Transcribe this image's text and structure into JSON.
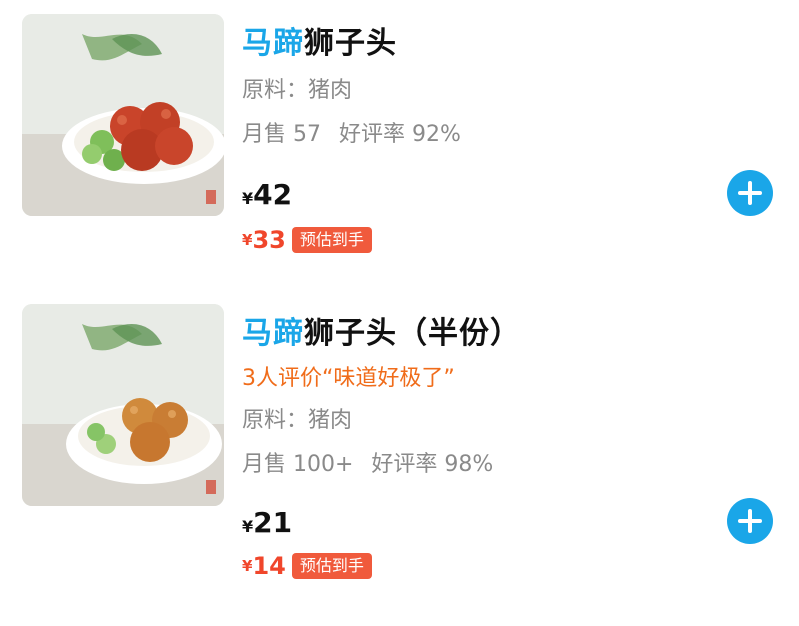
{
  "items": [
    {
      "title_highlight": "马蹄",
      "title_rest": "狮子头",
      "review": "",
      "ingredients_label": "原料：",
      "ingredients_value": "猪肉",
      "monthly_sales": "月售 57",
      "rating": "好评率 92%",
      "currency": "¥",
      "price": "42",
      "deal_price": "33",
      "deal_tag": "预估到手",
      "image_caption": "马蹄狮子头",
      "colors": {
        "highlight": "#1aa6e8",
        "deal": "#f0462b"
      }
    },
    {
      "title_highlight": "马蹄",
      "title_rest": "狮子头（半份）",
      "review": "3人评价“味道好极了”",
      "ingredients_label": "原料：",
      "ingredients_value": "猪肉",
      "monthly_sales": "月售 100+",
      "rating": "好评率 98%",
      "currency": "¥",
      "price": "21",
      "deal_price": "14",
      "deal_tag": "预估到手",
      "image_caption": "马蹄狮子头",
      "colors": {
        "highlight": "#1aa6e8",
        "deal": "#f0462b"
      }
    }
  ],
  "icons": {
    "add": "plus-circle-icon"
  }
}
